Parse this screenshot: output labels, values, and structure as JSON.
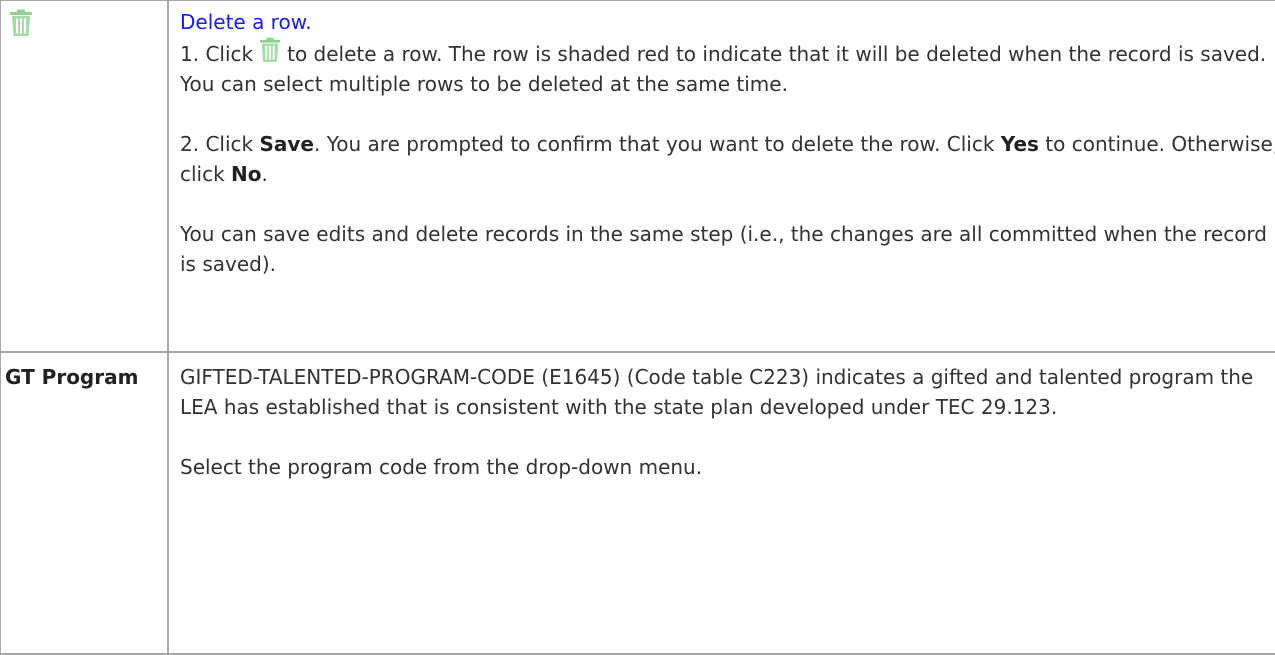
{
  "delete_row": {
    "icon": "trash-icon",
    "link_label": "Delete a row.",
    "step1_before_icon": "1. Click",
    "step1_after_icon": "to delete a row. The row is shaded red to indicate that it will be deleted when the record is saved. You can select multiple rows to be deleted at the same time.",
    "step2_prefix": "2. Click",
    "step2_save": "Save",
    "step2_middle": ". You are prompted to confirm that you want to delete the row. Click",
    "step2_yes": "Yes",
    "step2_continue": "to continue. Otherwise, click",
    "step2_no": "No",
    "step2_end": ".",
    "note": "You can save edits and delete records in the same step (i.e., the changes are all committed when the record is saved)."
  },
  "gt_program": {
    "field_name": "GT Program",
    "description": "GIFTED-TALENTED-PROGRAM-CODE (E1645) (Code table C223) indicates a gifted and talented program the LEA has established that is consistent with the state plan developed under TEC 29.123.",
    "instruction": "Select the program code from the drop-down menu."
  },
  "colors": {
    "link": "#1a1aff",
    "border": "#a8a8a8",
    "icon": "#8fd18f"
  }
}
